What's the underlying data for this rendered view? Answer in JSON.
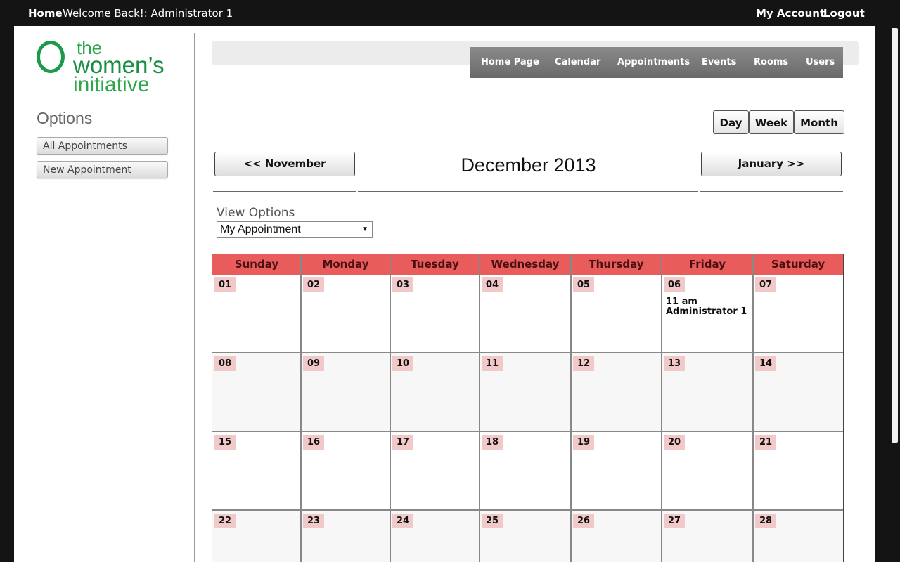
{
  "topbar": {
    "home": "Home",
    "welcome": "Welcome Back!: Administrator 1",
    "my_account": "My Account",
    "logout": "Logout"
  },
  "logo": {
    "line1": "the",
    "line2": "women’s",
    "line3": "initiative"
  },
  "sidebar": {
    "heading": "Options",
    "buttons": [
      "All Appointments",
      "New Appointment"
    ]
  },
  "nav": [
    "Home Page",
    "Calendar",
    "Appointments",
    "Events",
    "Rooms",
    "Users"
  ],
  "views": [
    "Day",
    "Week",
    "Month"
  ],
  "calendar": {
    "prev": "<< November",
    "title": "December 2013",
    "next": "January >>",
    "view_options_label": "View Options",
    "view_options_selected": "My Appointment",
    "days": [
      "Sunday",
      "Monday",
      "Tuesday",
      "Wednesday",
      "Thursday",
      "Friday",
      "Saturday"
    ],
    "weeks": [
      [
        "01",
        "02",
        "03",
        "04",
        "05",
        "06",
        "07"
      ],
      [
        "08",
        "09",
        "10",
        "11",
        "12",
        "13",
        "14"
      ],
      [
        "15",
        "16",
        "17",
        "18",
        "19",
        "20",
        "21"
      ],
      [
        "22",
        "23",
        "24",
        "25",
        "26",
        "27",
        "28"
      ]
    ],
    "event": {
      "date": "06",
      "time": "11 am",
      "who": "Administrator 1"
    }
  },
  "colors": {
    "header_red": "#e85c5c",
    "date_pink": "#f2c9c9",
    "logo_green": "#1a9a4a"
  }
}
